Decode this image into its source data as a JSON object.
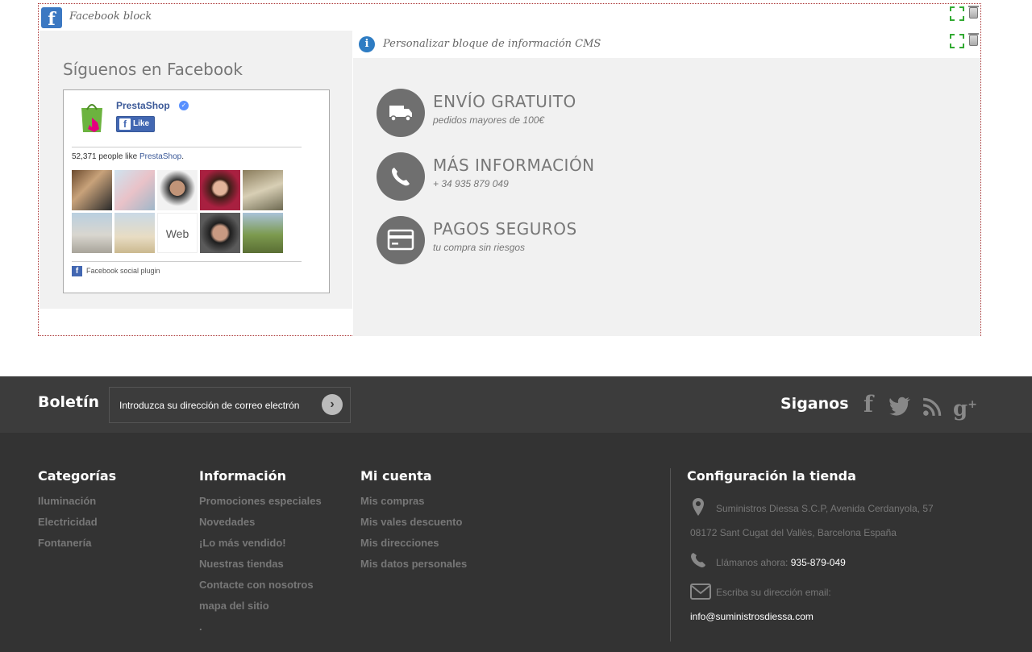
{
  "facebook_block": {
    "block_title": "Facebook block",
    "heading": "Síguenos en Facebook",
    "page_name": "PrestaShop",
    "like_label": "Like",
    "likes_count": "52,371 people like",
    "likes_page": "PrestaShop",
    "likes_suffix": ".",
    "plugin_label": "Facebook social plugin"
  },
  "cms_block": {
    "block_title": "Personalizar bloque de información CMS",
    "items": [
      {
        "title": "ENVÍO GRATUITO",
        "subtitle": "pedidos mayores de 100€",
        "icon": "truck-icon"
      },
      {
        "title": "MÁS INFORMACIÓN",
        "subtitle": "+ 34 935 879 049",
        "icon": "phone-icon"
      },
      {
        "title": "PAGOS SEGUROS",
        "subtitle": "tu compra sin riesgos",
        "icon": "credit-card-icon"
      }
    ]
  },
  "newsletter": {
    "title": "Boletín",
    "placeholder": "Introduzca su dirección de correo electrón"
  },
  "social": {
    "title": "Siganos",
    "networks": [
      "facebook",
      "twitter",
      "rss",
      "google-plus"
    ]
  },
  "footer": {
    "categories": {
      "title": "Categorías",
      "items": [
        "Iluminación",
        "Electricidad",
        "Fontanería"
      ]
    },
    "information": {
      "title": "Información",
      "items": [
        "Promociones especiales",
        "Novedades",
        "¡Lo más vendido!",
        "Nuestras tiendas",
        "Contacte con nosotros",
        "mapa del sitio"
      ],
      "trailing": "."
    },
    "account": {
      "title": "Mi cuenta",
      "items": [
        "Mis compras",
        "Mis vales descuento",
        "Mis direcciones",
        "Mis datos personales"
      ]
    },
    "store": {
      "title": "Configuración la tienda",
      "address_line1": "Suministros Diessa S.C.P, Avenida Cerdanyola, 57",
      "address_line2": "08172 Sant Cugat del Vallès, Barcelona España",
      "call_label": "Llámanos ahora:",
      "phone": "935-879-049",
      "email_label": "Escriba su dirección email:",
      "email": "info@suministrosdiessa.com"
    }
  },
  "colors": {
    "footer_bg": "#333333",
    "newsletter_bg": "#3c3c3c",
    "panel_bg": "#f1f1f1",
    "icon_circle": "#6f6f6f"
  }
}
